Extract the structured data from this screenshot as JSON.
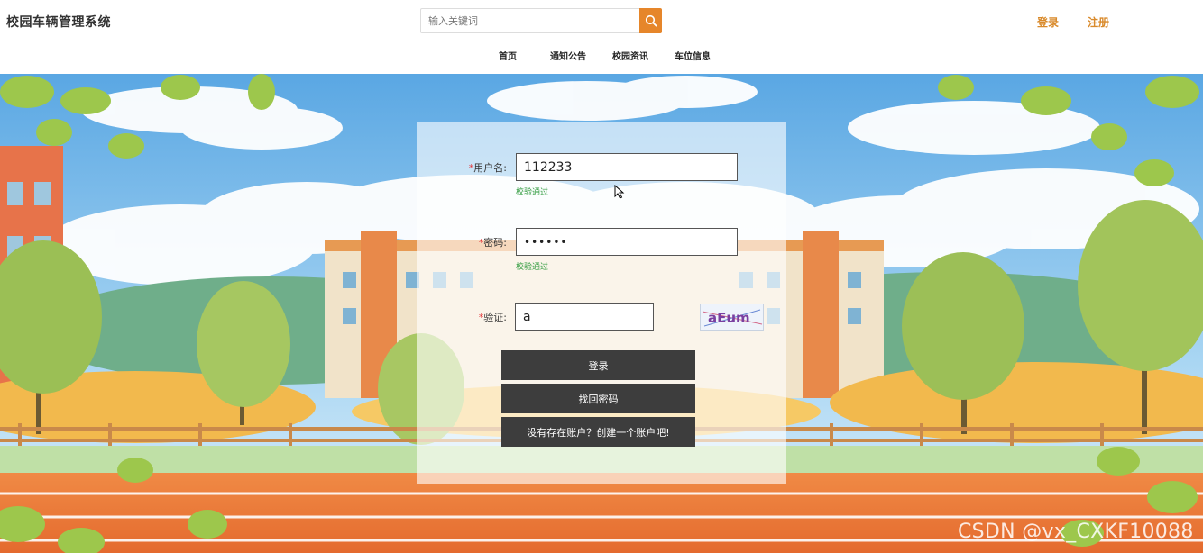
{
  "header": {
    "site_title": "校园车辆管理系统",
    "search_placeholder": "输入关键词",
    "login_link": "登录",
    "register_link": "注册",
    "nav": [
      "首页",
      "通知公告",
      "校园资讯",
      "车位信息"
    ]
  },
  "login_form": {
    "username_label": "用户名:",
    "username_value": "112233",
    "username_hint": "校验通过",
    "password_label": "密码:",
    "password_value": "••••••",
    "password_hint": "校验通过",
    "captcha_label": "验证:",
    "captcha_value": "a",
    "captcha_image_text": "aEum",
    "required_marker": "*",
    "login_button": "登录",
    "recover_button": "找回密码",
    "create_account_button": "没有存在账户？创建一个账户吧!"
  },
  "watermark": "CSDN @vx_CXKF10088",
  "colors": {
    "accent": "#e6862a",
    "link": "#d98a2b",
    "button": "#3d3d3d",
    "hint": "#2e9a3c"
  }
}
